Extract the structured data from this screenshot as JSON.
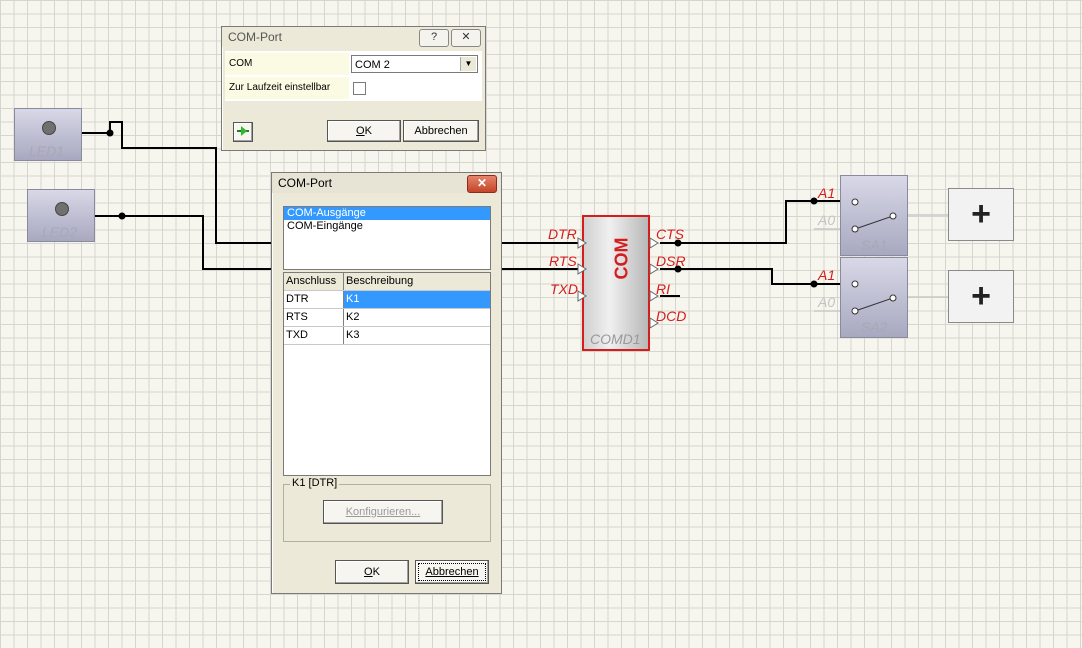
{
  "canvas": {
    "led1_label": "LED1",
    "led2_label": "LED2",
    "sa1_label": "SA1",
    "sa2_label": "SA2",
    "switch_pin_a1": "A1",
    "switch_pin_a0": "A0",
    "plus_symbol": "+",
    "com_block": {
      "title": "COM",
      "name": "COMD1",
      "pins_left": [
        "DTR",
        "RTS",
        "TXD"
      ],
      "pins_right": [
        "CTS",
        "DSR",
        "RI",
        "DCD"
      ]
    },
    "colors": {
      "wire": "#000000",
      "pin_red": "#d61c1c",
      "block_border": "#d61c1c"
    }
  },
  "small_dialog": {
    "title": "COM-Port",
    "help_btn": "?",
    "close_btn": "✕",
    "props": {
      "com_label": "COM",
      "com_value": "COM 2",
      "runtime_label": "Zur Laufzeit einstellbar",
      "runtime_checked": false
    },
    "ok_prefix": "",
    "ok_hotkey": "O",
    "ok_rest": "K",
    "cancel_label": "Abbrechen"
  },
  "main_dialog": {
    "title": "COM-Port",
    "close_btn": "✕",
    "list": [
      "COM-Ausgänge",
      "COM-Eingänge"
    ],
    "selected_list_index": 0,
    "grid_headers": [
      "Anschluss",
      "Beschreibung"
    ],
    "grid_rows": [
      {
        "pin": "DTR",
        "desc": "K1"
      },
      {
        "pin": "RTS",
        "desc": "K2"
      },
      {
        "pin": "TXD",
        "desc": "K3"
      }
    ],
    "group_label": "K1 [DTR]",
    "configure_button": "Konfigurieren...",
    "ok_hotkey": "O",
    "ok_rest": "K",
    "cancel_label": "Abbrechen"
  }
}
